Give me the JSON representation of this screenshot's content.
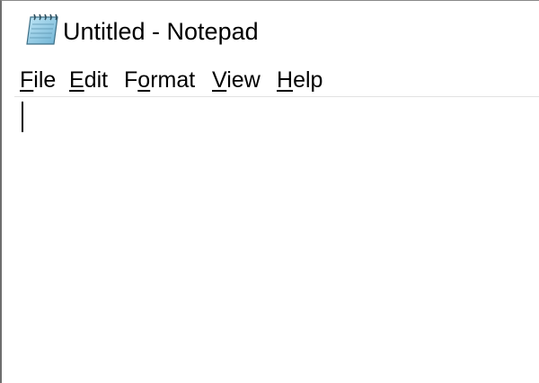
{
  "window": {
    "title": "Untitled - Notepad",
    "icon": "notepad-icon"
  },
  "menu": {
    "items": [
      {
        "pre": "",
        "key": "F",
        "post": "ile"
      },
      {
        "pre": "",
        "key": "E",
        "post": "dit"
      },
      {
        "pre": "F",
        "key": "o",
        "post": "rmat"
      },
      {
        "pre": "",
        "key": "V",
        "post": "iew"
      },
      {
        "pre": "",
        "key": "H",
        "post": "elp"
      }
    ]
  },
  "editor": {
    "text": ""
  }
}
